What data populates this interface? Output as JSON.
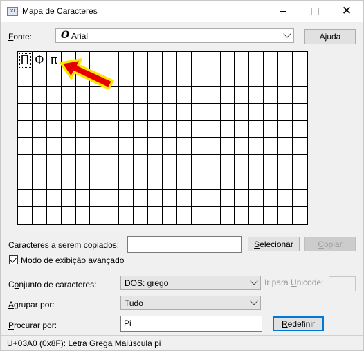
{
  "window": {
    "app_icon": "XI",
    "title": "Mapa de Caracteres"
  },
  "font_row": {
    "label_pre": "",
    "label_accel": "F",
    "label_post": "onte:",
    "font_glyph": "O",
    "font_name": "Arial",
    "help_pre": "A",
    "help_accel": "j",
    "help_post": "uda"
  },
  "grid": {
    "columns": 20,
    "rows": 10,
    "glyphs": [
      "Π",
      "Φ",
      "π"
    ],
    "selected_index": 0,
    "annotation": "red-arrow-pointing-at-pi"
  },
  "copy_row": {
    "label": "Caracteres a serem copiados:",
    "value": "",
    "select_pre": "",
    "select_accel": "S",
    "select_post": "elecionar",
    "copy_pre": "",
    "copy_accel": "C",
    "copy_post": "opiar"
  },
  "advanced": {
    "checked": true,
    "label_pre": "",
    "label_accel": "M",
    "label_post": "odo de exibição avançado"
  },
  "charset": {
    "label_pre": "C",
    "label_accel": "o",
    "label_post": "njunto de caracteres:",
    "value": "DOS: grego",
    "unicode_label_pre": "Ir para ",
    "unicode_label_accel": "U",
    "unicode_label_post": "nicode:",
    "unicode_value": ""
  },
  "group": {
    "label_pre": "",
    "label_accel": "A",
    "label_post": "grupar por:",
    "value": "Tudo"
  },
  "search": {
    "label_pre": "",
    "label_accel": "P",
    "label_post": "rocurar por:",
    "value": "Pi",
    "reset_pre": "",
    "reset_accel": "R",
    "reset_post": "edefinir"
  },
  "status": {
    "text": "U+03A0 (0x8F): Letra Grega Maiúscula pi"
  },
  "colors": {
    "arrow_fill": "#e60000",
    "arrow_outline": "#ffe600",
    "focus_blue": "#0078d7"
  }
}
